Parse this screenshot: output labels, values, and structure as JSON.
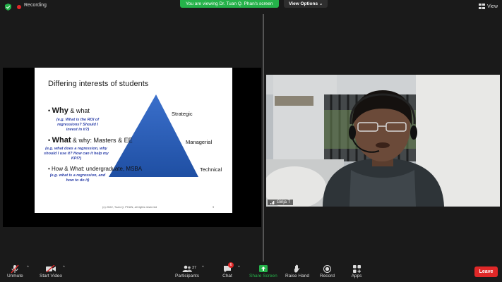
{
  "top": {
    "recording_label": "Recording",
    "viewing_banner": "You are viewing Dr. Tuan Q. Phan's screen",
    "view_options": "View Options",
    "view_label": "View"
  },
  "slide": {
    "title": "Differing interests of students",
    "pyramid_levels": [
      "Strategic",
      "Managerial",
      "Technical"
    ],
    "bullets": [
      {
        "bold": "Why",
        "rest": " & what",
        "sub": "(e.g. What is the ROI of regressions?  Should I invest in it?)"
      },
      {
        "bold": "What",
        "rest": " & why: Masters & EE",
        "sub": "(e.g. what does a regression, why should I use it?  How can it help my KPI?)"
      },
      {
        "bold": "",
        "rest": "How & What: undergraduate, MSBA",
        "sub": "(e.g. what is a regression, and how to do it)"
      }
    ],
    "copyright": "(c) 2022, Tuan Q. PHAN, all rights reserved",
    "page_number": "9"
  },
  "video": {
    "participant_name": "Girija T"
  },
  "toolbar": {
    "unmute": "Unmute",
    "start_video": "Start Video",
    "participants": "Participants",
    "participants_count": "37",
    "chat": "Chat",
    "chat_badge": "6",
    "share_screen": "Share Screen",
    "raise_hand": "Raise Hand",
    "record": "Record",
    "apps": "Apps",
    "leave": "Leave"
  },
  "colors": {
    "share_green": "#25b24a",
    "leave_red": "#e02828",
    "pyramid_blue": "#2a5db5"
  }
}
